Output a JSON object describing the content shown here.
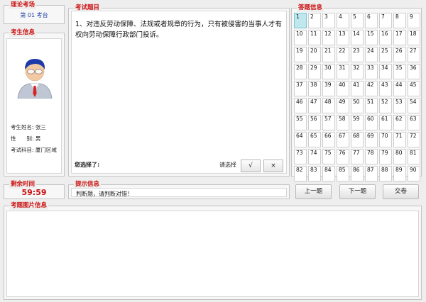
{
  "exam_room": {
    "title": "理论考场",
    "room_label": "第 01 考台"
  },
  "candidate": {
    "title": "考生信息",
    "name_line": "考生姓名: 张三",
    "gender_line": "性　　别: 男",
    "subject_line": "考试科目: 厦门区域"
  },
  "question": {
    "title": "考试题目",
    "text": "1、对违反劳动保障、法规或者规章的行为，只有被侵害的当事人才有权向劳动保障行政部门投诉。",
    "your_choice_label": "您选择了:",
    "please_choose_label": "请选择",
    "true_button": "√",
    "false_button": "×"
  },
  "answers": {
    "title": "答题信息",
    "current": "1",
    "cells": [
      "1",
      "2",
      "3",
      "4",
      "5",
      "6",
      "7",
      "8",
      "9",
      "10",
      "11",
      "12",
      "13",
      "14",
      "15",
      "16",
      "17",
      "18",
      "19",
      "20",
      "21",
      "22",
      "23",
      "24",
      "25",
      "26",
      "27",
      "28",
      "29",
      "30",
      "31",
      "32",
      "33",
      "34",
      "35",
      "36",
      "37",
      "38",
      "39",
      "40",
      "41",
      "42",
      "43",
      "44",
      "45",
      "46",
      "47",
      "48",
      "49",
      "50",
      "51",
      "52",
      "53",
      "54",
      "55",
      "56",
      "57",
      "58",
      "59",
      "60",
      "61",
      "62",
      "63",
      "64",
      "65",
      "66",
      "67",
      "68",
      "69",
      "70",
      "71",
      "72",
      "73",
      "74",
      "75",
      "76",
      "77",
      "78",
      "79",
      "80",
      "81",
      "82",
      "83",
      "84",
      "85",
      "86",
      "87",
      "88",
      "89",
      "90"
    ]
  },
  "timer": {
    "title": "剩余时间",
    "value": "59:59"
  },
  "hint": {
    "title": "提示信息",
    "text": "判断题，请判断对错！"
  },
  "nav": {
    "prev_label": "上一题",
    "next_label": "下一题",
    "submit_label": "交卷"
  },
  "image_panel": {
    "title": "考题图片信息"
  },
  "colors": {
    "title_red": "#cc1111",
    "room_blue": "#1a3ea5",
    "current_cell": "#bfe7ee"
  }
}
